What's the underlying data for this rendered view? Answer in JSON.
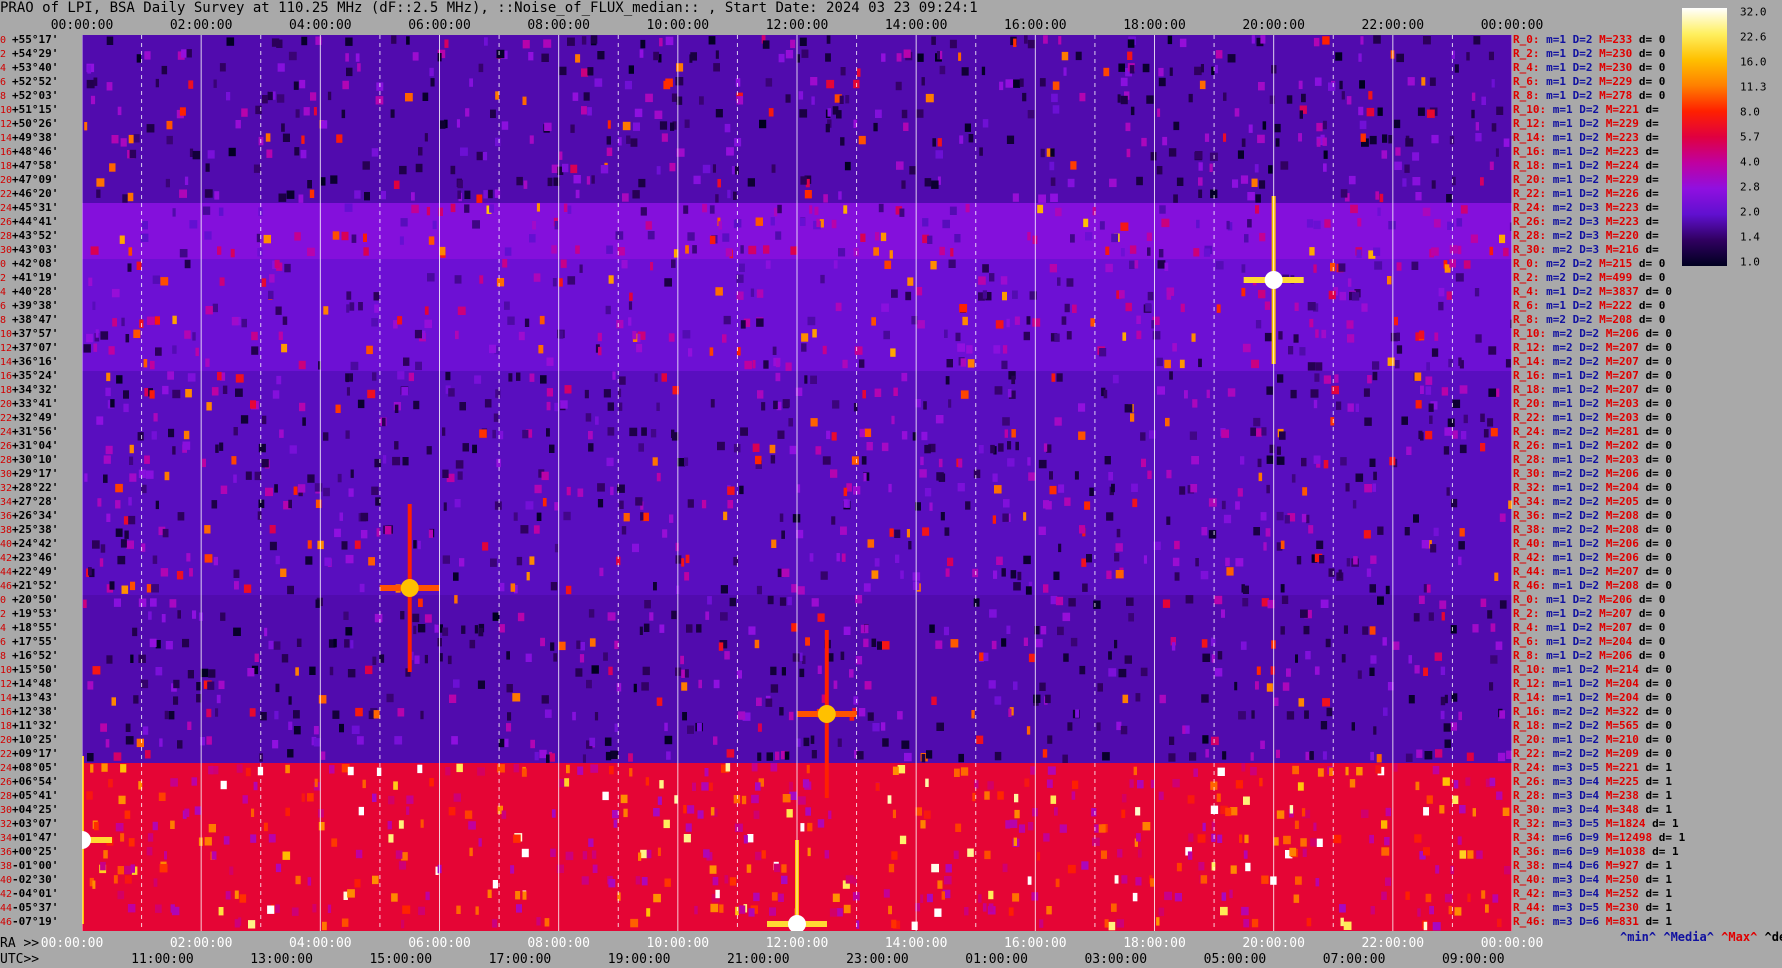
{
  "header": {
    "title": "PRAO of LPI, BSA Daily Survey at 110.25 MHz (dF::2.5 MHz), ::Noise_of_FLUX_median:: , Start Date: 2024 03 23 09:24:1"
  },
  "axes": {
    "top_ticks": [
      "00:00:00",
      "02:00:00",
      "04:00:00",
      "06:00:00",
      "08:00:00",
      "10:00:00",
      "12:00:00",
      "14:00:00",
      "16:00:00",
      "18:00:00",
      "20:00:00",
      "22:00:00",
      "00:00:00"
    ],
    "ra_prefix": "RA >>",
    "ra_ticks": [
      "00:00:00",
      "02:00:00",
      "04:00:00",
      "06:00:00",
      "08:00:00",
      "10:00:00",
      "12:00:00",
      "14:00:00",
      "16:00:00",
      "18:00:00",
      "20:00:00",
      "22:00:00",
      "00:00:00"
    ],
    "utc_prefix": "UTC>>",
    "utc_ticks": [
      "11:00:00",
      "13:00:00",
      "15:00:00",
      "17:00:00",
      "19:00:00",
      "21:00:00",
      "23:00:00",
      "01:00:00",
      "03:00:00",
      "05:00:00",
      "07:00:00",
      "09:00:00"
    ]
  },
  "declinations": [
    {
      "idx": "0",
      "dec": "+55°17'"
    },
    {
      "idx": "2",
      "dec": "+54°29'"
    },
    {
      "idx": "4",
      "dec": "+53°40'"
    },
    {
      "idx": "6",
      "dec": "+52°52'"
    },
    {
      "idx": "8",
      "dec": "+52°03'"
    },
    {
      "idx": "10",
      "dec": "+51°15'"
    },
    {
      "idx": "12",
      "dec": "+50°26'"
    },
    {
      "idx": "14",
      "dec": "+49°38'"
    },
    {
      "idx": "16",
      "dec": "+48°46'"
    },
    {
      "idx": "18",
      "dec": "+47°58'"
    },
    {
      "idx": "20",
      "dec": "+47°09'"
    },
    {
      "idx": "22",
      "dec": "+46°20'"
    },
    {
      "idx": "24",
      "dec": "+45°31'"
    },
    {
      "idx": "26",
      "dec": "+44°41'"
    },
    {
      "idx": "28",
      "dec": "+43°52'"
    },
    {
      "idx": "30",
      "dec": "+43°03'"
    },
    {
      "idx": "0",
      "dec": "+42°08'"
    },
    {
      "idx": "2",
      "dec": "+41°19'"
    },
    {
      "idx": "4",
      "dec": "+40°28'"
    },
    {
      "idx": "6",
      "dec": "+39°38'"
    },
    {
      "idx": "8",
      "dec": "+38°47'"
    },
    {
      "idx": "10",
      "dec": "+37°57'"
    },
    {
      "idx": "12",
      "dec": "+37°07'"
    },
    {
      "idx": "14",
      "dec": "+36°16'"
    },
    {
      "idx": "16",
      "dec": "+35°24'"
    },
    {
      "idx": "18",
      "dec": "+34°32'"
    },
    {
      "idx": "20",
      "dec": "+33°41'"
    },
    {
      "idx": "22",
      "dec": "+32°49'"
    },
    {
      "idx": "24",
      "dec": "+31°56'"
    },
    {
      "idx": "26",
      "dec": "+31°04'"
    },
    {
      "idx": "28",
      "dec": "+30°10'"
    },
    {
      "idx": "30",
      "dec": "+29°17'"
    },
    {
      "idx": "32",
      "dec": "+28°22'"
    },
    {
      "idx": "34",
      "dec": "+27°28'"
    },
    {
      "idx": "36",
      "dec": "+26°34'"
    },
    {
      "idx": "38",
      "dec": "+25°38'"
    },
    {
      "idx": "40",
      "dec": "+24°42'"
    },
    {
      "idx": "42",
      "dec": "+23°46'"
    },
    {
      "idx": "44",
      "dec": "+22°49'"
    },
    {
      "idx": "46",
      "dec": "+21°52'"
    },
    {
      "idx": "0",
      "dec": "+20°50'"
    },
    {
      "idx": "2",
      "dec": "+19°53'"
    },
    {
      "idx": "4",
      "dec": "+18°55'"
    },
    {
      "idx": "6",
      "dec": "+17°55'"
    },
    {
      "idx": "8",
      "dec": "+16°52'"
    },
    {
      "idx": "10",
      "dec": "+15°50'"
    },
    {
      "idx": "12",
      "dec": "+14°48'"
    },
    {
      "idx": "14",
      "dec": "+13°43'"
    },
    {
      "idx": "16",
      "dec": "+12°38'"
    },
    {
      "idx": "18",
      "dec": "+11°32'"
    },
    {
      "idx": "20",
      "dec": "+10°25'"
    },
    {
      "idx": "22",
      "dec": "+09°17'"
    },
    {
      "idx": "24",
      "dec": "+08°05'"
    },
    {
      "idx": "26",
      "dec": "+06°54'"
    },
    {
      "idx": "28",
      "dec": "+05°41'"
    },
    {
      "idx": "30",
      "dec": "+04°25'"
    },
    {
      "idx": "32",
      "dec": "+03°07'"
    },
    {
      "idx": "34",
      "dec": "+01°47'"
    },
    {
      "idx": "36",
      "dec": "+00°25'"
    },
    {
      "idx": "38",
      "dec": "-01°00'"
    },
    {
      "idx": "40",
      "dec": "-02°30'"
    },
    {
      "idx": "42",
      "dec": "-04°01'"
    },
    {
      "idx": "44",
      "dec": "-05°37'"
    },
    {
      "idx": "46",
      "dec": "-07°19'"
    }
  ],
  "stats": [
    {
      "r": "R_0:",
      "m": "m=1",
      "D": "D=2",
      "M": "M=233",
      "d": "d= 0"
    },
    {
      "r": "R_2:",
      "m": "m=1",
      "D": "D=2",
      "M": "M=230",
      "d": "d= 0"
    },
    {
      "r": "R_4:",
      "m": "m=1",
      "D": "D=2",
      "M": "M=230",
      "d": "d= 0"
    },
    {
      "r": "R_6:",
      "m": "m=1",
      "D": "D=2",
      "M": "M=229",
      "d": "d= 0"
    },
    {
      "r": "R_8:",
      "m": "m=1",
      "D": "D=2",
      "M": "M=278",
      "d": "d= 0"
    },
    {
      "r": "R_10:",
      "m": "m=1",
      "D": "D=2",
      "M": "M=221",
      "d": "d="
    },
    {
      "r": "R_12:",
      "m": "m=1",
      "D": "D=2",
      "M": "M=229",
      "d": "d="
    },
    {
      "r": "R_14:",
      "m": "m=1",
      "D": "D=2",
      "M": "M=223",
      "d": "d="
    },
    {
      "r": "R_16:",
      "m": "m=1",
      "D": "D=2",
      "M": "M=223",
      "d": "d="
    },
    {
      "r": "R_18:",
      "m": "m=1",
      "D": "D=2",
      "M": "M=224",
      "d": "d="
    },
    {
      "r": "R_20:",
      "m": "m=1",
      "D": "D=2",
      "M": "M=229",
      "d": "d="
    },
    {
      "r": "R_22:",
      "m": "m=1",
      "D": "D=2",
      "M": "M=226",
      "d": "d="
    },
    {
      "r": "R_24:",
      "m": "m=2",
      "D": "D=3",
      "M": "M=223",
      "d": "d="
    },
    {
      "r": "R_26:",
      "m": "m=2",
      "D": "D=3",
      "M": "M=223",
      "d": "d="
    },
    {
      "r": "R_28:",
      "m": "m=2",
      "D": "D=3",
      "M": "M=220",
      "d": "d="
    },
    {
      "r": "R_30:",
      "m": "m=2",
      "D": "D=3",
      "M": "M=216",
      "d": "d="
    },
    {
      "r": "R_0:",
      "m": "m=2",
      "D": "D=2",
      "M": "M=215",
      "d": "d= 0"
    },
    {
      "r": "R_2:",
      "m": "m=2",
      "D": "D=2",
      "M": "M=499",
      "d": "d= 0"
    },
    {
      "r": "R_4:",
      "m": "m=1",
      "D": "D=2",
      "M": "M=3837",
      "d": "d= 0"
    },
    {
      "r": "R_6:",
      "m": "m=1",
      "D": "D=2",
      "M": "M=222",
      "d": "d= 0"
    },
    {
      "r": "R_8:",
      "m": "m=2",
      "D": "D=2",
      "M": "M=208",
      "d": "d= 0"
    },
    {
      "r": "R_10:",
      "m": "m=2",
      "D": "D=2",
      "M": "M=206",
      "d": "d= 0"
    },
    {
      "r": "R_12:",
      "m": "m=2",
      "D": "D=2",
      "M": "M=207",
      "d": "d= 0"
    },
    {
      "r": "R_14:",
      "m": "m=2",
      "D": "D=2",
      "M": "M=207",
      "d": "d= 0"
    },
    {
      "r": "R_16:",
      "m": "m=1",
      "D": "D=2",
      "M": "M=207",
      "d": "d= 0"
    },
    {
      "r": "R_18:",
      "m": "m=1",
      "D": "D=2",
      "M": "M=207",
      "d": "d= 0"
    },
    {
      "r": "R_20:",
      "m": "m=1",
      "D": "D=2",
      "M": "M=203",
      "d": "d= 0"
    },
    {
      "r": "R_22:",
      "m": "m=1",
      "D": "D=2",
      "M": "M=203",
      "d": "d= 0"
    },
    {
      "r": "R_24:",
      "m": "m=2",
      "D": "D=2",
      "M": "M=281",
      "d": "d= 0"
    },
    {
      "r": "R_26:",
      "m": "m=1",
      "D": "D=2",
      "M": "M=202",
      "d": "d= 0"
    },
    {
      "r": "R_28:",
      "m": "m=1",
      "D": "D=2",
      "M": "M=203",
      "d": "d= 0"
    },
    {
      "r": "R_30:",
      "m": "m=2",
      "D": "D=2",
      "M": "M=206",
      "d": "d= 0"
    },
    {
      "r": "R_32:",
      "m": "m=1",
      "D": "D=2",
      "M": "M=204",
      "d": "d= 0"
    },
    {
      "r": "R_34:",
      "m": "m=2",
      "D": "D=2",
      "M": "M=205",
      "d": "d= 0"
    },
    {
      "r": "R_36:",
      "m": "m=2",
      "D": "D=2",
      "M": "M=208",
      "d": "d= 0"
    },
    {
      "r": "R_38:",
      "m": "m=2",
      "D": "D=2",
      "M": "M=208",
      "d": "d= 0"
    },
    {
      "r": "R_40:",
      "m": "m=1",
      "D": "D=2",
      "M": "M=206",
      "d": "d= 0"
    },
    {
      "r": "R_42:",
      "m": "m=1",
      "D": "D=2",
      "M": "M=206",
      "d": "d= 0"
    },
    {
      "r": "R_44:",
      "m": "m=1",
      "D": "D=2",
      "M": "M=207",
      "d": "d= 0"
    },
    {
      "r": "R_46:",
      "m": "m=1",
      "D": "D=2",
      "M": "M=208",
      "d": "d= 0"
    },
    {
      "r": "R_0:",
      "m": "m=1",
      "D": "D=2",
      "M": "M=206",
      "d": "d= 0"
    },
    {
      "r": "R_2:",
      "m": "m=1",
      "D": "D=2",
      "M": "M=207",
      "d": "d= 0"
    },
    {
      "r": "R_4:",
      "m": "m=1",
      "D": "D=2",
      "M": "M=207",
      "d": "d= 0"
    },
    {
      "r": "R_6:",
      "m": "m=1",
      "D": "D=2",
      "M": "M=204",
      "d": "d= 0"
    },
    {
      "r": "R_8:",
      "m": "m=1",
      "D": "D=2",
      "M": "M=206",
      "d": "d= 0"
    },
    {
      "r": "R_10:",
      "m": "m=1",
      "D": "D=2",
      "M": "M=214",
      "d": "d= 0"
    },
    {
      "r": "R_12:",
      "m": "m=1",
      "D": "D=2",
      "M": "M=204",
      "d": "d= 0"
    },
    {
      "r": "R_14:",
      "m": "m=1",
      "D": "D=2",
      "M": "M=204",
      "d": "d= 0"
    },
    {
      "r": "R_16:",
      "m": "m=2",
      "D": "D=2",
      "M": "M=322",
      "d": "d= 0"
    },
    {
      "r": "R_18:",
      "m": "m=2",
      "D": "D=2",
      "M": "M=565",
      "d": "d= 0"
    },
    {
      "r": "R_20:",
      "m": "m=1",
      "D": "D=2",
      "M": "M=210",
      "d": "d= 0"
    },
    {
      "r": "R_22:",
      "m": "m=2",
      "D": "D=2",
      "M": "M=209",
      "d": "d= 0"
    },
    {
      "r": "R_24:",
      "m": "m=3",
      "D": "D=5",
      "M": "M=221",
      "d": "d= 1"
    },
    {
      "r": "R_26:",
      "m": "m=3",
      "D": "D=4",
      "M": "M=225",
      "d": "d= 1"
    },
    {
      "r": "R_28:",
      "m": "m=3",
      "D": "D=4",
      "M": "M=238",
      "d": "d= 1"
    },
    {
      "r": "R_30:",
      "m": "m=3",
      "D": "D=4",
      "M": "M=348",
      "d": "d= 1"
    },
    {
      "r": "R_32:",
      "m": "m=3",
      "D": "D=5",
      "M": "M=1824",
      "d": "d= 1"
    },
    {
      "r": "R_34:",
      "m": "m=6",
      "D": "D=9",
      "M": "M=12498",
      "d": "d= 1"
    },
    {
      "r": "R_36:",
      "m": "m=6",
      "D": "D=9",
      "M": "M=1038",
      "d": "d= 1"
    },
    {
      "r": "R_38:",
      "m": "m=4",
      "D": "D=6",
      "M": "M=927",
      "d": "d= 1"
    },
    {
      "r": "R_40:",
      "m": "m=3",
      "D": "D=4",
      "M": "M=250",
      "d": "d= 1"
    },
    {
      "r": "R_42:",
      "m": "m=3",
      "D": "D=4",
      "M": "M=252",
      "d": "d= 1"
    },
    {
      "r": "R_44:",
      "m": "m=3",
      "D": "D=5",
      "M": "M=230",
      "d": "d= 1"
    },
    {
      "r": "R_46:",
      "m": "m=3",
      "D": "D=6",
      "M": "M=831",
      "d": "d= 1"
    }
  ],
  "legend": {
    "min": "^min^",
    "median": "^Media^",
    "max": "^Max^",
    "devia": "^devia^",
    "min_color": "#1010a0",
    "median_color": "#1010a0",
    "max_color": "#e00000",
    "devia_color": "#000000"
  },
  "colorbar": {
    "labels": [
      "32.0",
      "22.6",
      "16.0",
      "11.3",
      "8.0",
      "5.7",
      "4.0",
      "2.8",
      "2.0",
      "1.4",
      "1.0"
    ],
    "stops": [
      "#ffffff",
      "#fff060",
      "#ffc000",
      "#ff8000",
      "#ff2000",
      "#e00040",
      "#c000a0",
      "#9010e0",
      "#6010d0",
      "#300060",
      "#000020"
    ]
  },
  "chart_data": {
    "type": "heatmap",
    "title": "PRAO of LPI, BSA Daily Survey at 110.25 MHz (dF::2.5 MHz), ::Noise_of_FLUX_median:: , Start Date: 2024 03 23 09:24:1",
    "x_axis": "RA (00:00:00 to 24:00:00)",
    "y_axis": "Declination (+55°17' to -07°19')",
    "color_scale": {
      "min": 1.0,
      "max": 32.0,
      "scale": "log2"
    },
    "row_count": 64,
    "band_levels": [
      {
        "rows": [
          0,
          11
        ],
        "level": 1.8
      },
      {
        "rows": [
          12,
          15
        ],
        "level": 2.6
      },
      {
        "rows": [
          16,
          23
        ],
        "level": 2.2
      },
      {
        "rows": [
          24,
          39
        ],
        "level": 1.9
      },
      {
        "rows": [
          40,
          51
        ],
        "level": 1.8
      },
      {
        "rows": [
          52,
          63
        ],
        "level": 6.0
      }
    ],
    "bright_sources": [
      {
        "ra": "20:00:00",
        "dec": "+41°19'",
        "level": 32.0
      },
      {
        "ra": "12:00:00",
        "dec": "-07°19'",
        "level": 32.0
      },
      {
        "ra": "00:00:00",
        "dec": "+01°47'",
        "level": 32.0
      },
      {
        "ra": "05:30:00",
        "dec": "+21°52'",
        "level": 16.0
      },
      {
        "ra": "12:30:00",
        "dec": "+12°38'",
        "level": 16.0
      }
    ]
  }
}
